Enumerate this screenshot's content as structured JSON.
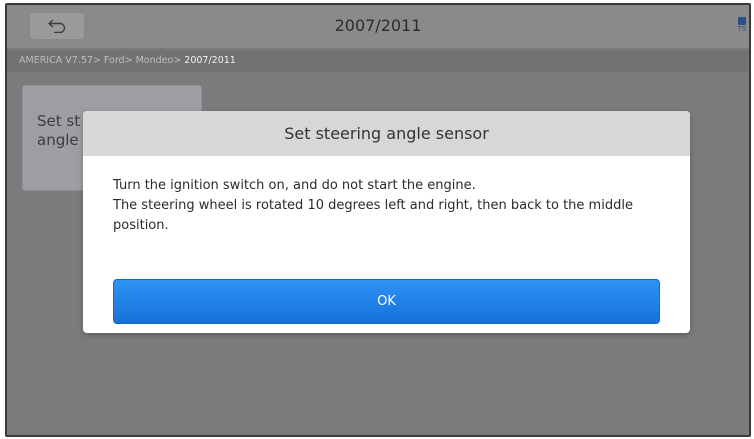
{
  "header": {
    "title": "2007/2011",
    "back_icon": "back-arrow-icon",
    "right_icon": "tsb-icon",
    "right_icon_text": "TS"
  },
  "breadcrumb": {
    "path": "AMERICA V7.57> Ford> Mondeo> ",
    "current": "2007/2011"
  },
  "menu": {
    "tile_line1": "Set st",
    "tile_line2": "angle"
  },
  "dialog": {
    "title": "Set steering angle sensor",
    "line1": "Turn the ignition switch on, and do not start the engine.",
    "line2": "The steering wheel is rotated 10 degrees left and right, then back to the middle position.",
    "ok_label": "OK"
  },
  "colors": {
    "ok_button": "#1f82e8",
    "dialog_header": "#d7d7d7",
    "overlay_background": "#7b7b7b"
  }
}
